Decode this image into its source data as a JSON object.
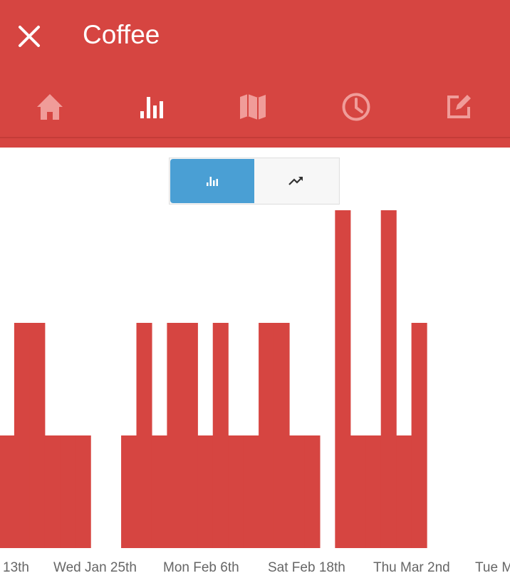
{
  "header": {
    "title": "Coffee",
    "close_icon": "close-icon",
    "background": "#d64541"
  },
  "nav": {
    "tabs": [
      {
        "name": "tab-home",
        "icon": "home-icon",
        "active": false
      },
      {
        "name": "tab-chart",
        "icon": "bar-chart-icon",
        "active": true
      },
      {
        "name": "tab-map",
        "icon": "map-icon",
        "active": false
      },
      {
        "name": "tab-history",
        "icon": "clock-icon",
        "active": false
      },
      {
        "name": "tab-edit",
        "icon": "edit-icon",
        "active": false
      }
    ]
  },
  "view_toggle": {
    "options": [
      {
        "icon": "bar-chart-icon",
        "selected": true,
        "color": "#4a9fd4"
      },
      {
        "icon": "trending-up-icon",
        "selected": false
      }
    ]
  },
  "chart_data": {
    "type": "bar",
    "title": "",
    "xlabel": "",
    "ylabel": "",
    "ylim": [
      0,
      3
    ],
    "color": "#d64541",
    "grid": false,
    "tick_labels": [
      "13th",
      "Wed Jan 25th",
      "Mon Feb 6th",
      "Sat Feb 18th",
      "Thu Mar 2nd",
      "Tue Mar"
    ],
    "bars": [
      {
        "day": 1,
        "value": 1
      },
      {
        "day": 2,
        "value": 2
      },
      {
        "day": 3,
        "value": 2
      },
      {
        "day": 4,
        "value": 1
      },
      {
        "day": 5,
        "value": 1
      },
      {
        "day": 6,
        "value": 1
      },
      {
        "day": 9,
        "value": 1
      },
      {
        "day": 10,
        "value": 2
      },
      {
        "day": 11,
        "value": 1
      },
      {
        "day": 12,
        "value": 2
      },
      {
        "day": 13,
        "value": 2
      },
      {
        "day": 14,
        "value": 1
      },
      {
        "day": 15,
        "value": 2
      },
      {
        "day": 16,
        "value": 1
      },
      {
        "day": 17,
        "value": 1
      },
      {
        "day": 18,
        "value": 2
      },
      {
        "day": 19,
        "value": 2
      },
      {
        "day": 20,
        "value": 1
      },
      {
        "day": 21,
        "value": 1
      },
      {
        "day": 23,
        "value": 3
      },
      {
        "day": 24,
        "value": 1
      },
      {
        "day": 25,
        "value": 1
      },
      {
        "day": 26,
        "value": 3
      },
      {
        "day": 27,
        "value": 1
      },
      {
        "day": 28,
        "value": 2
      }
    ]
  }
}
